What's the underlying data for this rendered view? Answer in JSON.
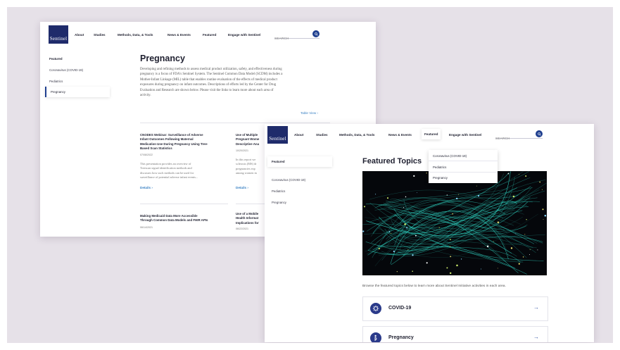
{
  "nav": {
    "logo": "Sentinel",
    "items": [
      "About",
      "Studies",
      "Methods, Data, & Tools",
      "News & Events",
      "Featured",
      "Engage with Sentinel"
    ],
    "search_placeholder": "SEARCH"
  },
  "sidebar": {
    "items": [
      "Featured",
      "Coronavirus (COVID-19)",
      "Pediatrics",
      "Pregnancy"
    ]
  },
  "pregnancy_page": {
    "title": "Pregnancy",
    "intro_lines": [
      "Developing and refining methods to assess medical product utilization, safety, and effectiveness during",
      "pregnancy is a focus of FDA's Sentinel System. The Sentinel Common Data Model (SCDM) includes a",
      "Mother-Infant Linkage (MIL) table that enables routine evaluation of the effects of medical product",
      "exposures during pregnancy on infant outcomes. Descriptions of efforts led by the Center for Drug",
      "Evaluation and Research are shown below. Please visit the links to learn more about each area of",
      "activity."
    ],
    "table_view": "Table View ›",
    "cards": [
      {
        "title_lines": [
          "CNODES Webinar: Surveillance of Adverse",
          "Infant Outcomes Following Maternal",
          "Medication Use During Pregnancy Using Tree-",
          "Based Scan Statistics"
        ],
        "date": "07/08/2022",
        "text_lines": [
          "This presentation provides an overview of",
          "Treescan signal identification methods and",
          "discusses how such methods can be used for",
          "surveillance of potential adverse infant events..."
        ],
        "details": "Details"
      },
      {
        "title_lines": [
          "Use of Multiple",
          "Pregnant Wome",
          "Descriptive Ana"
        ],
        "date": "10/20/2021",
        "text_lines": [
          "In this report we",
          "sclerosis (MS) dr",
          "pregnancies exp",
          "among women in"
        ],
        "details": "Details"
      },
      {
        "title_lines": [
          "Making Medicaid Data More Accessible",
          "Through Common Data Models and FHIR APIs"
        ],
        "date": "06/14/2021",
        "text_lines": [],
        "details": ""
      },
      {
        "title_lines": [
          "Use of a Mobile",
          "Health Informat",
          "Implications for"
        ],
        "date": "06/22/2021",
        "text_lines": [],
        "details": ""
      }
    ]
  },
  "featured_page": {
    "title": "Featured Topics",
    "dropdown_items": [
      "Coronavirus (COVID-19)",
      "Pediatrics",
      "Pregnancy"
    ],
    "browse_text": "Browse the featured topics below to learn more about Sentinel Initiative activities in each area.",
    "topics": [
      {
        "label": "COVID-19",
        "icon": "virus-icon"
      },
      {
        "label": "Pregnancy",
        "icon": "pregnancy-icon"
      }
    ]
  },
  "colors": {
    "navy": "#1f2b6b",
    "accent": "#1f3f8f",
    "link": "#3b82c4",
    "hero_lines": "#2fd6c4"
  }
}
